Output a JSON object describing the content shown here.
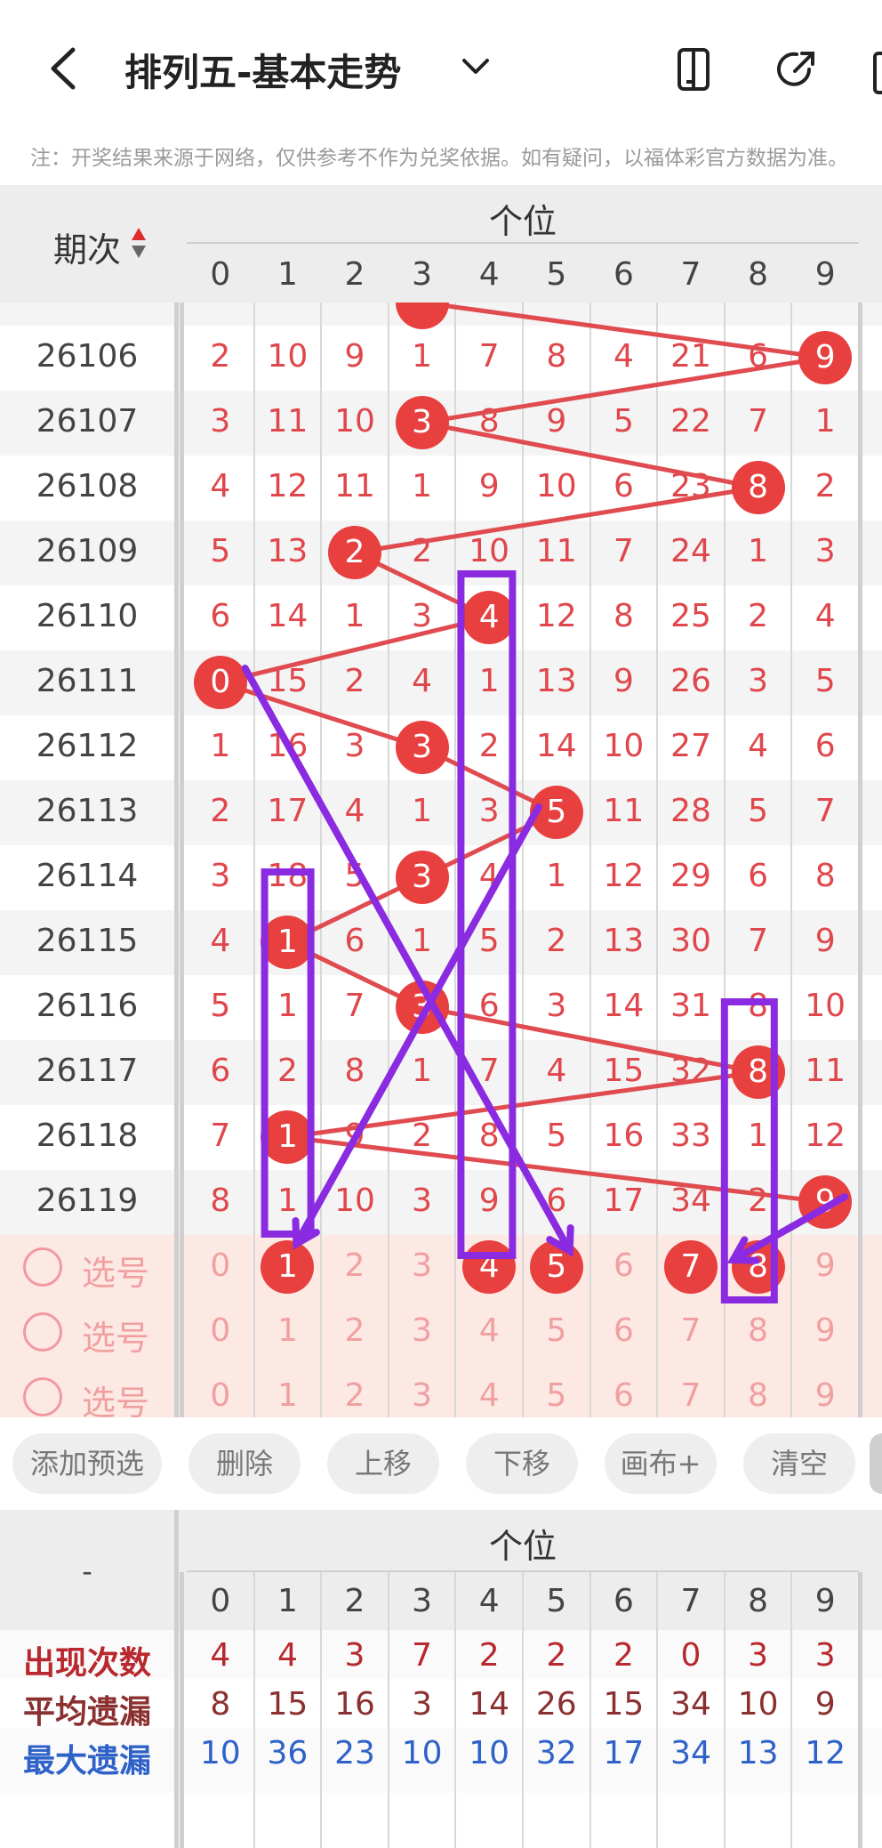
{
  "header": {
    "title": "排列五-基本走势",
    "notice": "注：开奖结果来源于网络，仅供参考不作为兑奖依据。如有疑问，以福体彩官方数据为准。"
  },
  "grid": {
    "issue_header": "期次",
    "position_title": "个位",
    "digits": [
      "0",
      "1",
      "2",
      "3",
      "4",
      "5",
      "6",
      "7",
      "8",
      "9"
    ],
    "rows": [
      {
        "issue": "26106",
        "cells": [
          "2",
          "10",
          "9",
          "1",
          "7",
          "8",
          "4",
          "21",
          "6",
          "9"
        ],
        "ball": 9
      },
      {
        "issue": "26107",
        "cells": [
          "3",
          "11",
          "10",
          "3",
          "8",
          "9",
          "5",
          "22",
          "7",
          "1"
        ],
        "ball": 3
      },
      {
        "issue": "26108",
        "cells": [
          "4",
          "12",
          "11",
          "1",
          "9",
          "10",
          "6",
          "23",
          "8",
          "2"
        ],
        "ball": 8
      },
      {
        "issue": "26109",
        "cells": [
          "5",
          "13",
          "2",
          "2",
          "10",
          "11",
          "7",
          "24",
          "1",
          "3"
        ],
        "ball": 2
      },
      {
        "issue": "26110",
        "cells": [
          "6",
          "14",
          "1",
          "3",
          "4",
          "12",
          "8",
          "25",
          "2",
          "4"
        ],
        "ball": 4
      },
      {
        "issue": "26111",
        "cells": [
          "0",
          "15",
          "2",
          "4",
          "1",
          "13",
          "9",
          "26",
          "3",
          "5"
        ],
        "ball": 0
      },
      {
        "issue": "26112",
        "cells": [
          "1",
          "16",
          "3",
          "3",
          "2",
          "14",
          "10",
          "27",
          "4",
          "6"
        ],
        "ball": 3
      },
      {
        "issue": "26113",
        "cells": [
          "2",
          "17",
          "4",
          "1",
          "3",
          "5",
          "11",
          "28",
          "5",
          "7"
        ],
        "ball": 5
      },
      {
        "issue": "26114",
        "cells": [
          "3",
          "18",
          "5",
          "3",
          "4",
          "1",
          "12",
          "29",
          "6",
          "8"
        ],
        "ball": 3
      },
      {
        "issue": "26115",
        "cells": [
          "4",
          "1",
          "6",
          "1",
          "5",
          "2",
          "13",
          "30",
          "7",
          "9"
        ],
        "ball": 1
      },
      {
        "issue": "26116",
        "cells": [
          "5",
          "1",
          "7",
          "3",
          "6",
          "3",
          "14",
          "31",
          "8",
          "10"
        ],
        "ball": 3
      },
      {
        "issue": "26117",
        "cells": [
          "6",
          "2",
          "8",
          "1",
          "7",
          "4",
          "15",
          "32",
          "8",
          "11"
        ],
        "ball": 8
      },
      {
        "issue": "26118",
        "cells": [
          "7",
          "1",
          "9",
          "2",
          "8",
          "5",
          "16",
          "33",
          "1",
          "12"
        ],
        "ball": 1
      },
      {
        "issue": "26119",
        "cells": [
          "8",
          "1",
          "10",
          "3",
          "9",
          "6",
          "17",
          "34",
          "2",
          "9"
        ],
        "ball": 9
      }
    ],
    "pick_label": "选号",
    "pick_rows": [
      {
        "cells": [
          "0",
          "1",
          "2",
          "3",
          "4",
          "5",
          "6",
          "7",
          "8",
          "9"
        ],
        "selected": [
          1,
          4,
          5,
          7,
          8
        ]
      },
      {
        "cells": [
          "0",
          "1",
          "2",
          "3",
          "4",
          "5",
          "6",
          "7",
          "8",
          "9"
        ],
        "selected": []
      },
      {
        "cells": [
          "0",
          "1",
          "2",
          "3",
          "4",
          "5",
          "6",
          "7",
          "8",
          "9"
        ],
        "selected": []
      }
    ]
  },
  "buttons": [
    "添加预选",
    "删除",
    "上移",
    "下移",
    "画布+",
    "清空"
  ],
  "stats": {
    "corner": "-",
    "position_title": "个位",
    "digits": [
      "0",
      "1",
      "2",
      "3",
      "4",
      "5",
      "6",
      "7",
      "8",
      "9"
    ],
    "rows": [
      {
        "label": "出现次数",
        "color": "#b8282e",
        "values": [
          "4",
          "4",
          "3",
          "7",
          "2",
          "2",
          "2",
          "0",
          "3",
          "3"
        ]
      },
      {
        "label": "平均遗漏",
        "color": "#8b3030",
        "values": [
          "8",
          "15",
          "16",
          "3",
          "14",
          "26",
          "15",
          "34",
          "10",
          "9"
        ]
      },
      {
        "label": "最大遗漏",
        "color": "#2e62c9",
        "values": [
          "10",
          "36",
          "23",
          "10",
          "10",
          "32",
          "17",
          "34",
          "13",
          "12"
        ]
      }
    ]
  },
  "colors": {
    "ball": "#e83f3f",
    "annotation": "#8a2be2",
    "trend_line": "#e04b50"
  }
}
